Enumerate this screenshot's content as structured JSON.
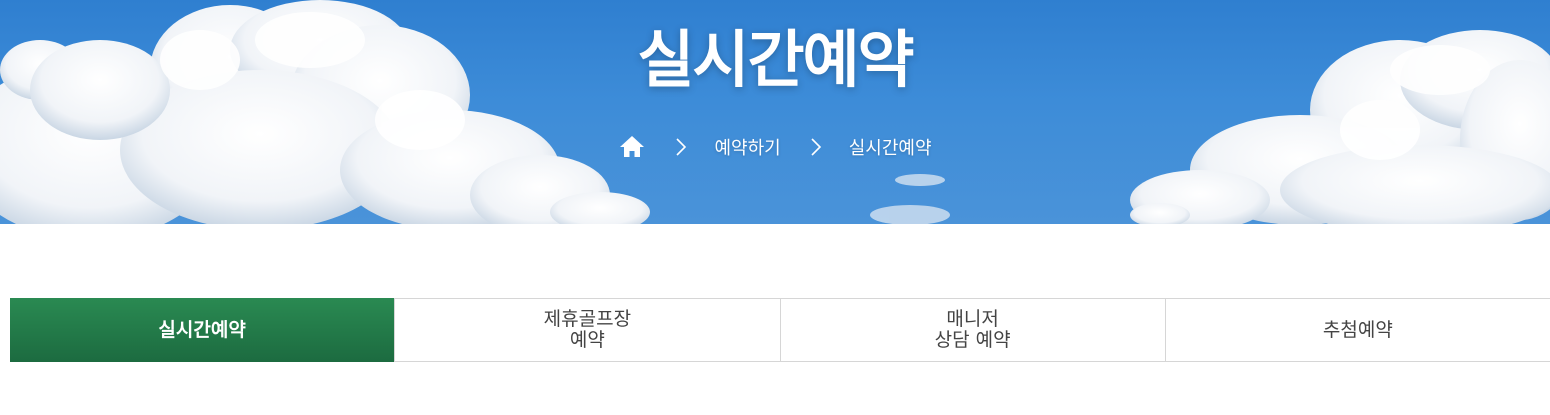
{
  "hero": {
    "title": "실시간예약",
    "sky_color": "#3a88d6"
  },
  "breadcrumb": {
    "home_icon": "home-icon",
    "separator_icon": "chevron-right-icon",
    "items": [
      {
        "label": "예약하기"
      },
      {
        "label": "실시간예약"
      }
    ]
  },
  "tabs": {
    "active_color": "#1f7445",
    "items": [
      {
        "label": "실시간예약",
        "active": true
      },
      {
        "label": "제휴골프장\n예약",
        "active": false
      },
      {
        "label": "매니저\n상담 예약",
        "active": false
      },
      {
        "label": "추첨예약",
        "active": false
      }
    ]
  }
}
